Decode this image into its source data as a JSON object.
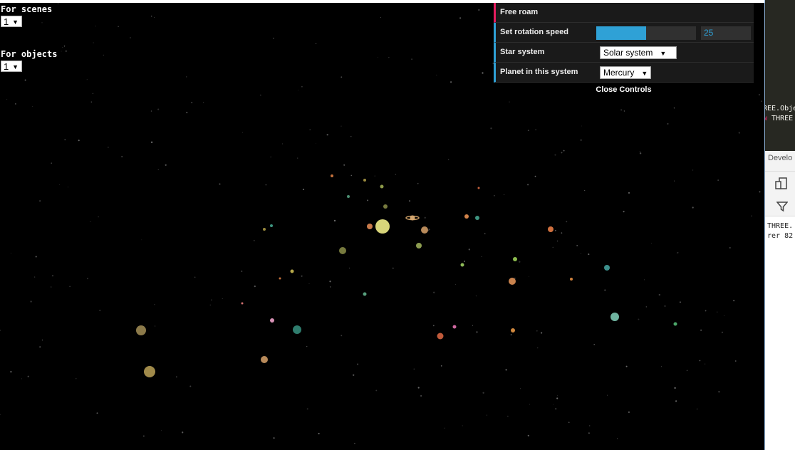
{
  "left_controls": {
    "scenes": {
      "label": "For scenes",
      "value": "1"
    },
    "objects": {
      "label": "For objects",
      "value": "1"
    }
  },
  "gui": {
    "free_roam": "Free roam",
    "rotation": {
      "label": "Set rotation speed",
      "value": "25",
      "fill_fraction": 0.5
    },
    "star_system": {
      "label": "Star system",
      "value": "Solar system"
    },
    "planet": {
      "label": "Planet in this system",
      "value": "Mercury"
    },
    "close": "Close Controls",
    "colors": {
      "function": "#e61d5f",
      "number": "#2fa1d6",
      "panel": "#1a1a1a"
    }
  },
  "devtools": {
    "code_line1": "REE.Obje",
    "code_kw": "w",
    "code_line2": " THREE",
    "tab": "Develo",
    "console_line1": "THREE.",
    "console_line2": "rer 82",
    "icons": [
      "device-icon",
      "filter-icon"
    ]
  }
}
